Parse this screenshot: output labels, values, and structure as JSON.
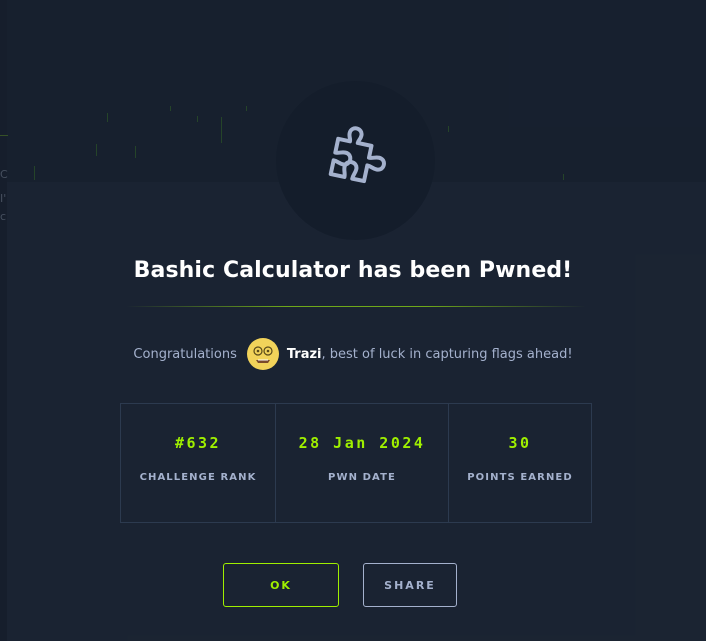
{
  "modal": {
    "title": "Bashic Calculator has been Pwned!",
    "icon": "puzzle-piece-icon",
    "congrats_prefix": "Congratulations",
    "username": "Trazi",
    "congrats_suffix": ", best of luck in capturing flags ahead!",
    "avatar": "user-avatar-emoji"
  },
  "stats": [
    {
      "value": "#632",
      "label": "CHALLENGE RANK"
    },
    {
      "value": "28 Jan 2024",
      "label": "PWN DATE"
    },
    {
      "value": "30",
      "label": "POINTS EARNED"
    }
  ],
  "buttons": {
    "ok": "OK",
    "share": "SHARE"
  },
  "background": {
    "fragments": [
      "C",
      "I'",
      "c"
    ]
  },
  "colors": {
    "accent": "#9fef00",
    "muted": "#a4b1cd",
    "panel": "#1a2332",
    "dark": "#141d2b"
  }
}
